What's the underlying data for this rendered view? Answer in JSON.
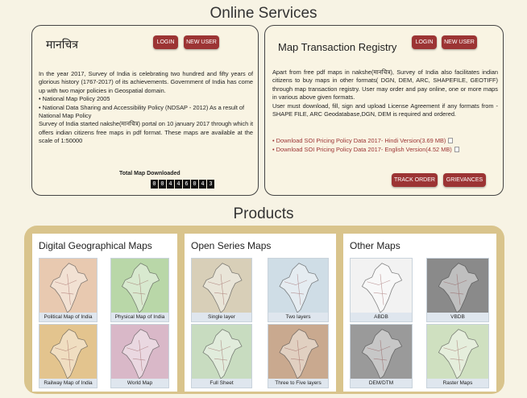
{
  "online_services": {
    "title": "Online Services",
    "left_card": {
      "heading": "मानचित्र",
      "login_label": "LOGIN",
      "new_user_label": "NEW USER",
      "para1": "In the year 2017, Survey of India is celebrating two hundred and fifty years of glorious history (1767-2017) of its achievements. Government of India has come up with two major policies in Geospatial domain.",
      "bullet1": "• National Map Policy 2005",
      "bullet2": "• National Data Sharing and Accessibility Policy (NDSAP - 2012) As a result of National Map Policy",
      "para2": "Survey of India started nakshe(मानचित्र) portal on 10 january 2017 through which it offers indian citizens free maps in pdf format. These maps are available at the scale of 1:50000",
      "counter_label": "Total Map Downloaded",
      "counter_digits": [
        "0",
        "0",
        "4",
        "4",
        "6",
        "0",
        "4",
        "3"
      ]
    },
    "right_card": {
      "heading": "Map Transaction Registry",
      "login_label": "LOGIN",
      "new_user_label": "NEW USER",
      "para1": "Apart from free pdf maps in nakshe(मानचित्र), Survey of India also facilitates indian citizens to buy maps in other formats( DGN, DEM, ARC, SHAPEFILE, GEOTIFF) through map transaction registry. User may order and pay online, one or more maps in various above given formats.",
      "para2": "User must download, fill, sign and upload License Agreement if any formats from -SHAPE FILE, ARC Geodatabase,DGN, DEM is required and ordered.",
      "link1": "• Download SOI Pricing Policy Data 2017- Hindi Version(3.69 MB)",
      "link2": "• Download SOI Pricing Policy Data 2017- English Version(4.52 MB)",
      "track_order_label": "TRACK ORDER",
      "grievances_label": "GRIEVANCES"
    }
  },
  "products": {
    "title": "Products",
    "panels": [
      {
        "title": "Digital Geographical Maps",
        "items": [
          {
            "caption": "Political Map of India",
            "tone": "#e8c9b0"
          },
          {
            "caption": "Physical Map of India",
            "tone": "#b9d7a8"
          },
          {
            "caption": "Railway Map of India",
            "tone": "#e3c48e"
          },
          {
            "caption": "World Map",
            "tone": "#d9b8c8"
          }
        ]
      },
      {
        "title": "Open Series Maps",
        "items": [
          {
            "caption": "Single layer",
            "tone": "#d8cfb8"
          },
          {
            "caption": "Two layers",
            "tone": "#cfdde6"
          },
          {
            "caption": "Full Sheet",
            "tone": "#c8dcc0"
          },
          {
            "caption": "Three to Five layers",
            "tone": "#c9a98f"
          }
        ]
      },
      {
        "title": "Other Maps",
        "items": [
          {
            "caption": "ABDB",
            "tone": "#f2f2f2"
          },
          {
            "caption": "VBDB",
            "tone": "#8a8a8a"
          },
          {
            "caption": "DEM/DTM",
            "tone": "#9a9a9a"
          },
          {
            "caption": "Raster Maps",
            "tone": "#cfe0c0"
          }
        ]
      }
    ]
  }
}
